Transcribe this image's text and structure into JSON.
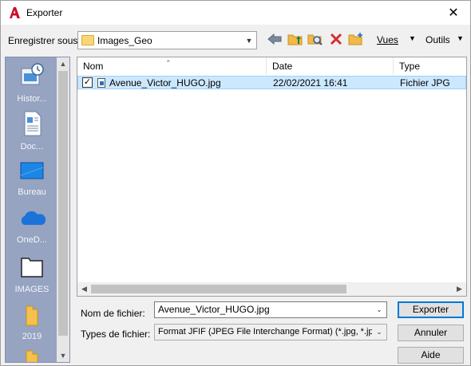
{
  "window": {
    "title": "Exporter",
    "close_glyph": "✕"
  },
  "toolbar": {
    "save_in_label": "Enregistrer sous:",
    "save_in_value": "Images_Geo",
    "views_label": "Vues",
    "tools_label": "Outils"
  },
  "places": [
    {
      "label": "Histor...",
      "icon": "history-icon"
    },
    {
      "label": "Doc...",
      "icon": "documents-icon"
    },
    {
      "label": "Bureau",
      "icon": "desktop-icon"
    },
    {
      "label": "OneD...",
      "icon": "onedrive-icon"
    },
    {
      "label": "IMAGES",
      "icon": "folder-outline-icon"
    },
    {
      "label": "2019",
      "icon": "folder-icon"
    }
  ],
  "filelist": {
    "columns": [
      "Nom",
      "Date",
      "Type"
    ],
    "rows": [
      {
        "name": "Avenue_Victor_HUGO.jpg",
        "date": "22/02/2021 16:41",
        "type": "Fichier JPG",
        "checked": true
      }
    ]
  },
  "form": {
    "filename_label": "Nom de fichier:",
    "filename_value": "Avenue_Victor_HUGO.jpg",
    "filetype_label": "Types de fichier:",
    "filetype_value": "Format JFIF (JPEG File Interchange Format) (*.jpg, *.jpeg)"
  },
  "buttons": {
    "export": "Exporter",
    "cancel": "Annuler",
    "help": "Aide"
  },
  "colors": {
    "sidebar": "#96a3c1",
    "selection": "#cce8ff",
    "accent": "#0078d7",
    "app_icon": "#c8102e"
  }
}
